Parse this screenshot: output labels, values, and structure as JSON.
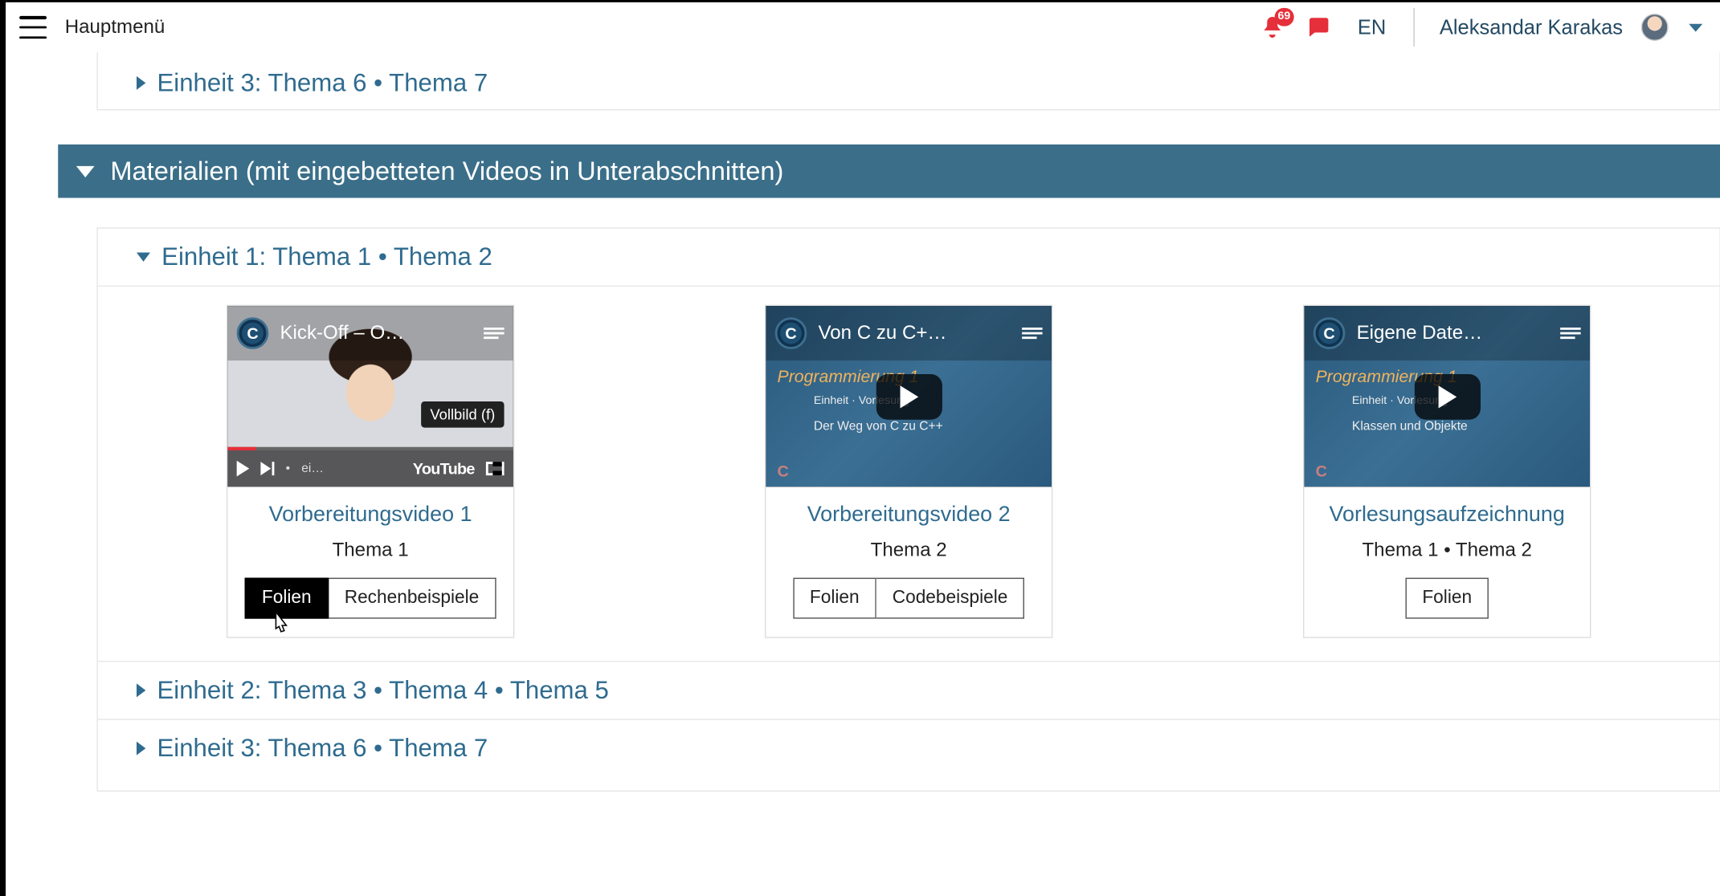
{
  "header": {
    "hauptmenu": "Hauptmenü",
    "notification_count": "69",
    "lang": "EN",
    "user_name": "Aleksandar Karakas"
  },
  "pre_section": {
    "row3": "Einheit 3: Thema 6 • Thema 7"
  },
  "section_materials": {
    "title": "Materialien (mit eingebetteten Videos in Unterabschnitten)",
    "unit1_title": "Einheit 1: Thema 1 • Thema 2",
    "unit2_title": "Einheit 2: Thema 3 • Thema 4 • Thema 5",
    "unit3_title": "Einheit 3: Thema 6 • Thema 7"
  },
  "cards": [
    {
      "yt_title": "Kick-Off – O…",
      "title": "Vorbereitungsvideo 1",
      "subtitle": "Thema 1",
      "tooltip": "Vollbild (f)",
      "yt_word": "YouTube",
      "time_label": "ei…",
      "btn1": "Folien",
      "btn2": "Rechenbeispiele"
    },
    {
      "yt_title": "Von C zu C+…",
      "slide_head": "Programmierung 1",
      "slide_mid": "Einheit · Vorlesung",
      "slide_sub": "Der Weg von C zu C++",
      "corner": "C",
      "title": "Vorbereitungsvideo 2",
      "subtitle": "Thema 2",
      "btn1": "Folien",
      "btn2": "Codebeispiele"
    },
    {
      "yt_title": "Eigene Date…",
      "slide_head": "Programmierung 1",
      "slide_mid": "Einheit · Vorlesung",
      "slide_sub": "Klassen und Objekte",
      "corner": "C",
      "title": "Vorlesungsaufzeichnung",
      "subtitle": "Thema 1 • Thema 2",
      "btn1": "Folien"
    }
  ]
}
